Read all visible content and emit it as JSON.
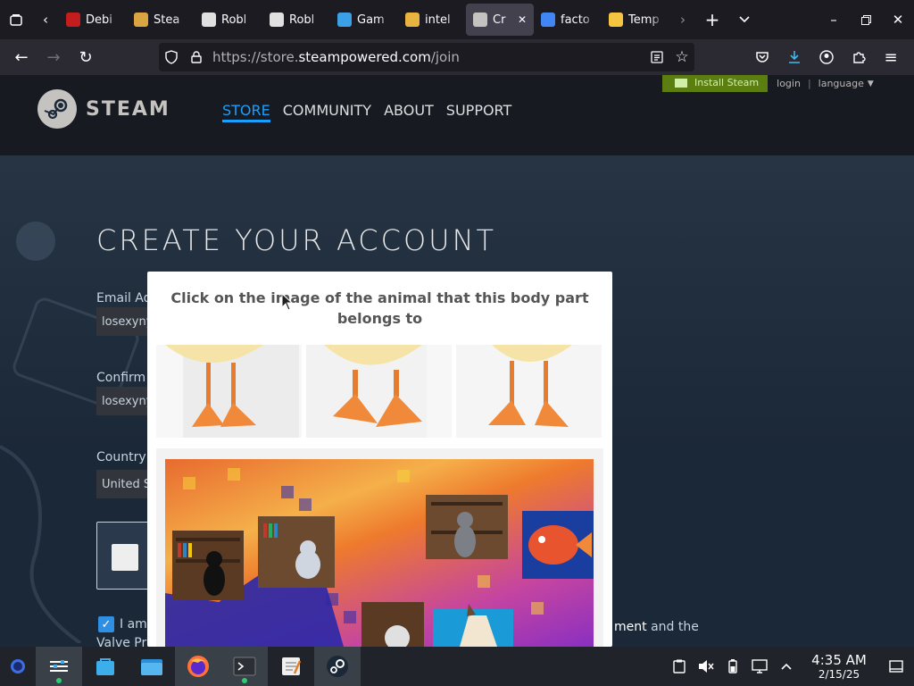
{
  "browser": {
    "tabs": [
      {
        "label": "Debi",
        "icon": "debian-icon",
        "color": "#c31d1d"
      },
      {
        "label": "Stea",
        "icon": "steam-person-icon",
        "color": "#d9a441"
      },
      {
        "label": "Robl",
        "icon": "roblox-icon",
        "color": "#e0e0e0"
      },
      {
        "label": "Robl",
        "icon": "roblox-icon",
        "color": "#e0e0e0"
      },
      {
        "label": "Gam",
        "icon": "globe-icon",
        "color": "#3ca0e6"
      },
      {
        "label": "intel",
        "icon": "grid-icon",
        "color": "#e8b341"
      },
      {
        "label": "Cr",
        "icon": "steam-icon",
        "color": "#c5c3c0"
      },
      {
        "label": "facto",
        "icon": "google-icon",
        "color": "#4285f4"
      },
      {
        "label": "Temp",
        "icon": "mail-icon",
        "color": "#f5c542"
      }
    ],
    "active_tab_index": 6,
    "url_prefix": "https://store.",
    "url_domain": "steampowered.com",
    "url_path": "/join"
  },
  "steam": {
    "logo_text": "STEAM",
    "nav": [
      "STORE",
      "COMMUNITY",
      "ABOUT",
      "SUPPORT"
    ],
    "install_label": "Install Steam",
    "login_label": "login",
    "language_label": "language",
    "page_title": "CREATE YOUR ACCOUNT",
    "email_label": "Email Ad",
    "email_value": "losexyny",
    "confirm_label": "Confirm",
    "confirm_value": "losexyny",
    "country_label": "Country",
    "country_value": "United S",
    "agree_text": "I am",
    "agree_text2": "Valve Pri",
    "agree_link": "ment",
    "agree_tail": "and the"
  },
  "captcha": {
    "prompt": "Click on the image of the animal that this body part belongs to"
  },
  "taskbar": {
    "time": "4:35 AM",
    "date": "2/15/25"
  },
  "colors": {
    "accent": "#1a9fff",
    "install_green": "#5c7e10",
    "steam_header": "#171a21"
  }
}
